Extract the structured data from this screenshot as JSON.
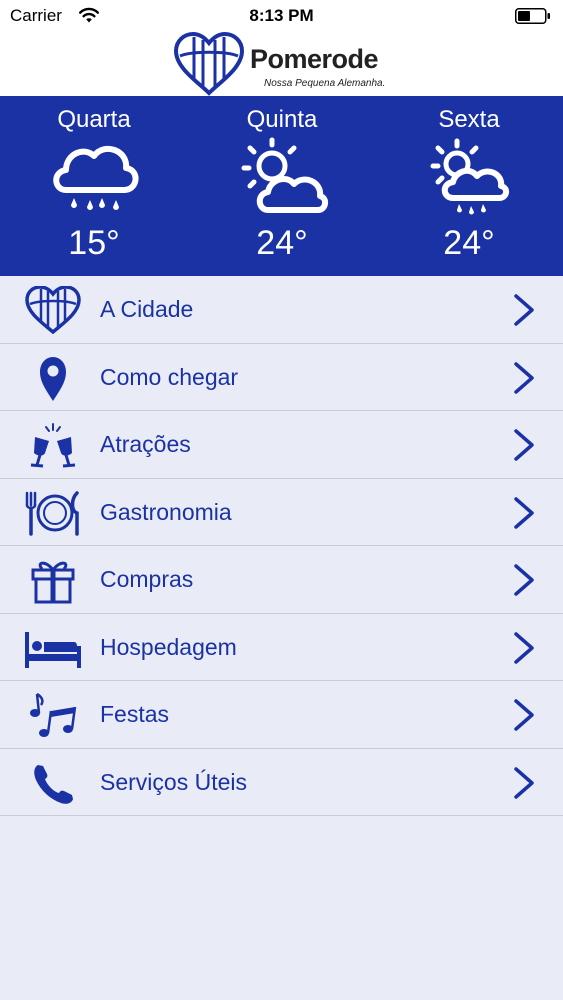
{
  "status_bar": {
    "carrier": "Carrier",
    "time": "8:13 PM"
  },
  "header": {
    "brand_name": "Pomerode",
    "tagline": "Nossa Pequena Alemanha."
  },
  "colors": {
    "primary_blue": "#1b32a4",
    "background": "#e9ecf6",
    "divider": "#c9ccd8"
  },
  "forecast": [
    {
      "day": "Quarta",
      "temp": "15°",
      "icon": "rain-cloud-icon"
    },
    {
      "day": "Quinta",
      "temp": "24°",
      "icon": "partly-sunny-icon"
    },
    {
      "day": "Sexta",
      "temp": "24°",
      "icon": "sun-rain-icon"
    }
  ],
  "menu": [
    {
      "label": "A Cidade",
      "icon": "heart-logo-icon"
    },
    {
      "label": "Como chegar",
      "icon": "map-pin-icon"
    },
    {
      "label": "Atrações",
      "icon": "toast-glasses-icon"
    },
    {
      "label": "Gastronomia",
      "icon": "plate-cutlery-icon"
    },
    {
      "label": "Compras",
      "icon": "gift-icon"
    },
    {
      "label": "Hospedagem",
      "icon": "bed-icon"
    },
    {
      "label": "Festas",
      "icon": "music-notes-icon"
    },
    {
      "label": "Serviços Úteis",
      "icon": "phone-icon"
    }
  ]
}
